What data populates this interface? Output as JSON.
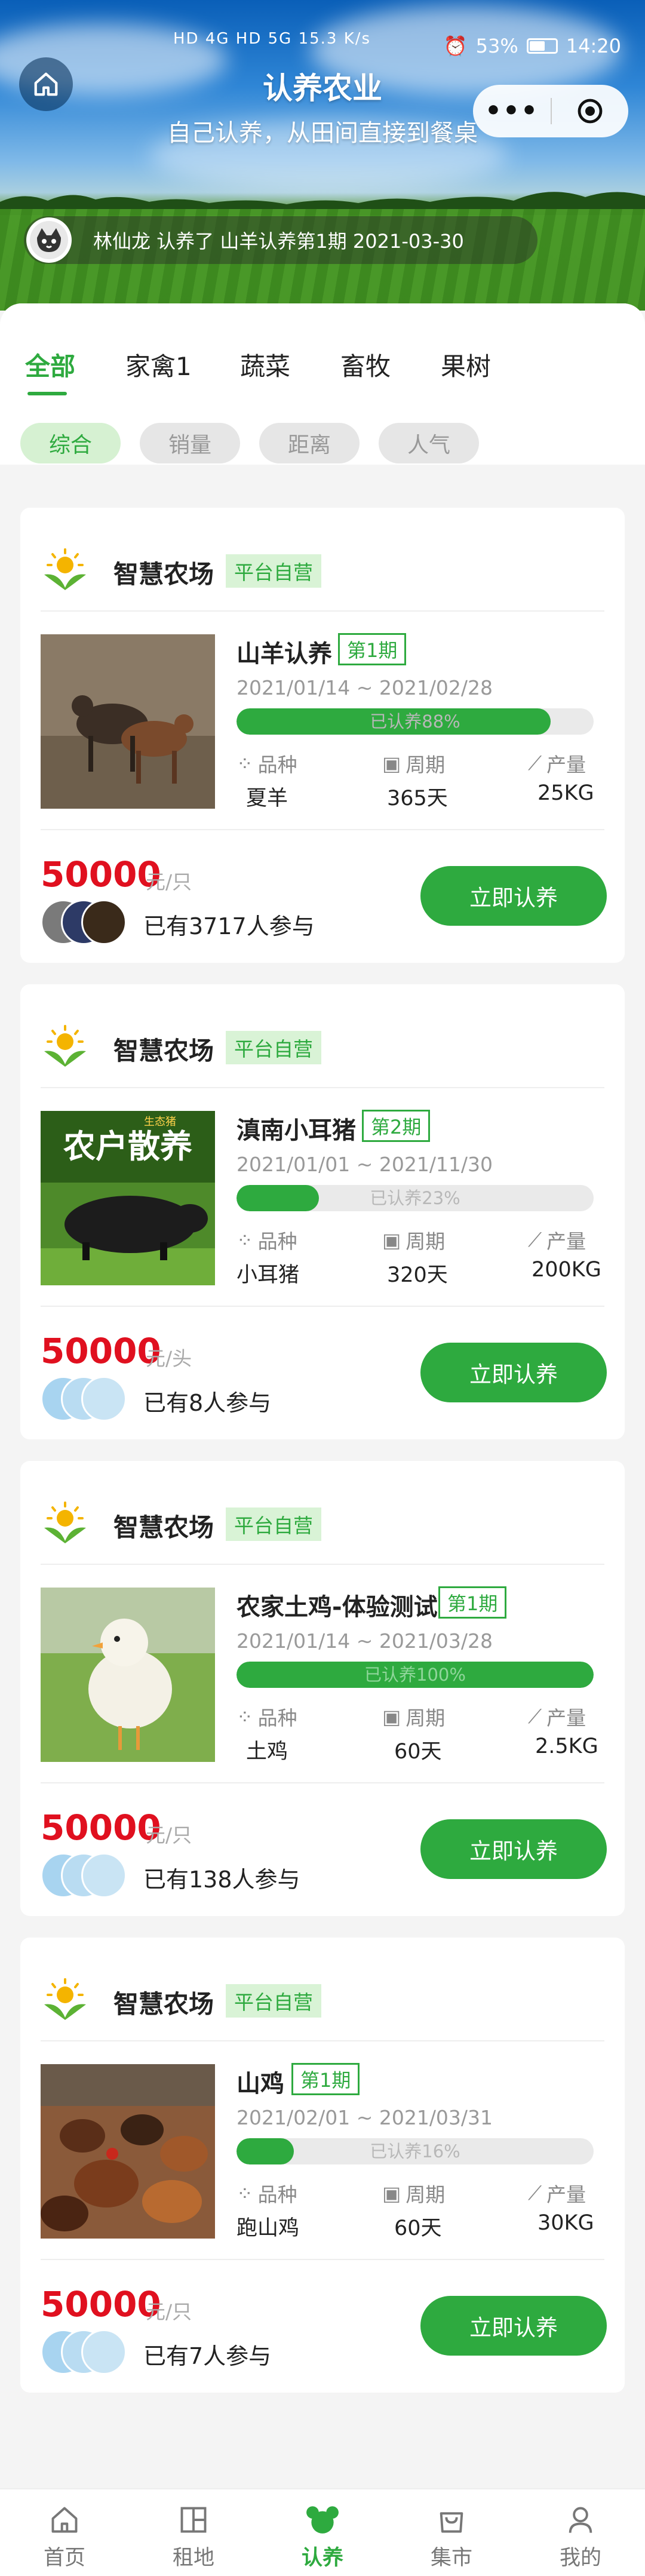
{
  "status_bar": {
    "network": "HD 4G HD 5G 15.3 K/s",
    "battery": "53%",
    "time": "14:20"
  },
  "header": {
    "title": "认养农业",
    "subtitle": "自己认养，从田间直接到餐桌",
    "capsule_more": "•••",
    "ticker": "林仙龙 认养了 山羊认养第1期 2021-03-30"
  },
  "tabs": [
    {
      "label": "全部",
      "active": true
    },
    {
      "label": "家禽1",
      "active": false
    },
    {
      "label": "蔬菜",
      "active": false
    },
    {
      "label": "畜牧",
      "active": false
    },
    {
      "label": "果树",
      "active": false
    }
  ],
  "sorts": [
    {
      "label": "综合",
      "active": true
    },
    {
      "label": "销量",
      "active": false
    },
    {
      "label": "距离",
      "active": false
    },
    {
      "label": "人气",
      "active": false
    }
  ],
  "labels": {
    "breed": "品种",
    "cycle": "周期",
    "output": "产量",
    "adopt_button": "立即认养"
  },
  "cards": [
    {
      "farm": "智慧农场",
      "tag": "平台自营",
      "name": "山羊认养",
      "period": "第1期",
      "dates": "2021/01/14 ~ 2021/02/28",
      "progress_text": "已认养88%",
      "progress": 0.88,
      "breed": "夏羊",
      "cycle": "365天",
      "output": "25KG",
      "price": "50000",
      "unit": "元/只",
      "joined": "已有3717人参与"
    },
    {
      "farm": "智慧农场",
      "tag": "平台自营",
      "name": "滇南小耳猪",
      "period": "第2期",
      "dates": "2021/01/01 ~ 2021/11/30",
      "progress_text": "已认养23%",
      "progress": 0.23,
      "breed": "小耳猪",
      "cycle": "320天",
      "output": "200KG",
      "price": "50000",
      "unit": "元/头",
      "joined": "已有8人参与",
      "thumb_text": "农户散养",
      "thumb_badge": "生态猪"
    },
    {
      "farm": "智慧农场",
      "tag": "平台自营",
      "name": "农家土鸡-体验测试",
      "period": "第1期",
      "dates": "2021/01/14 ~ 2021/03/28",
      "progress_text": "已认养100%",
      "progress": 1.0,
      "breed": "土鸡",
      "cycle": "60天",
      "output": "2.5KG",
      "price": "50000",
      "unit": "元/只",
      "joined": "已有138人参与"
    },
    {
      "farm": "智慧农场",
      "tag": "平台自营",
      "name": "山鸡",
      "period": "第1期",
      "dates": "2021/02/01 ~ 2021/03/31",
      "progress_text": "已认养16%",
      "progress": 0.16,
      "breed": "跑山鸡",
      "cycle": "60天",
      "output": "30KG",
      "price": "50000",
      "unit": "元/只",
      "joined": "已有7人参与"
    }
  ],
  "bottom_nav": [
    {
      "label": "首页",
      "icon": "home-icon",
      "active": false
    },
    {
      "label": "租地",
      "icon": "grid-icon",
      "active": false
    },
    {
      "label": "认养",
      "icon": "mickey-icon",
      "active": true
    },
    {
      "label": "集市",
      "icon": "shopping-bag-icon",
      "active": false
    },
    {
      "label": "我的",
      "icon": "user-icon",
      "active": false
    }
  ],
  "colors": {
    "accent": "#2eaa3f",
    "price": "#e0101f",
    "tag_bg": "#d9f3d6"
  }
}
